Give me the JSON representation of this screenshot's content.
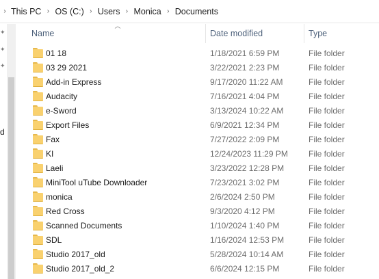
{
  "breadcrumb": [
    "This PC",
    "OS (C:)",
    "Users",
    "Monica",
    "Documents"
  ],
  "nav": {
    "partial_text": "d"
  },
  "columns": {
    "name": "Name",
    "date": "Date modified",
    "type": "Type"
  },
  "rows": [
    {
      "name": "01 18",
      "date": "1/18/2021 6:59 PM",
      "type": "File folder"
    },
    {
      "name": "03 29 2021",
      "date": "3/22/2021 2:23 PM",
      "type": "File folder"
    },
    {
      "name": "Add-in Express",
      "date": "9/17/2020 11:22 AM",
      "type": "File folder"
    },
    {
      "name": "Audacity",
      "date": "7/16/2021 4:04 PM",
      "type": "File folder"
    },
    {
      "name": "e-Sword",
      "date": "3/13/2024 10:22 AM",
      "type": "File folder"
    },
    {
      "name": "Export Files",
      "date": "6/9/2021 12:34 PM",
      "type": "File folder"
    },
    {
      "name": "Fax",
      "date": "7/27/2022 2:09 PM",
      "type": "File folder"
    },
    {
      "name": "KI",
      "date": "12/24/2023 11:29 PM",
      "type": "File folder"
    },
    {
      "name": "Laeli",
      "date": "3/23/2022 12:28 PM",
      "type": "File folder"
    },
    {
      "name": "MiniTool uTube Downloader",
      "date": "7/23/2021 3:02 PM",
      "type": "File folder"
    },
    {
      "name": "monica",
      "date": "2/6/2024 2:50 PM",
      "type": "File folder"
    },
    {
      "name": "Red Cross",
      "date": "9/3/2020 4:12 PM",
      "type": "File folder"
    },
    {
      "name": "Scanned Documents",
      "date": "1/10/2024 1:40 PM",
      "type": "File folder"
    },
    {
      "name": "SDL",
      "date": "1/16/2024 12:53 PM",
      "type": "File folder"
    },
    {
      "name": "Studio 2017_old",
      "date": "5/28/2024 10:14 AM",
      "type": "File folder"
    },
    {
      "name": "Studio 2017_old_2",
      "date": "6/6/2024 12:15 PM",
      "type": "File folder"
    }
  ],
  "colors": {
    "folder": "#f9d16f",
    "folder_tab": "#e6b84c",
    "header_text": "#4c607a",
    "meta_text": "#6d6d6d"
  },
  "icons": {
    "folder": "folder-icon",
    "pin": "pin-icon",
    "sort": "sort-ascending-icon",
    "separator": "chevron-right-icon"
  }
}
